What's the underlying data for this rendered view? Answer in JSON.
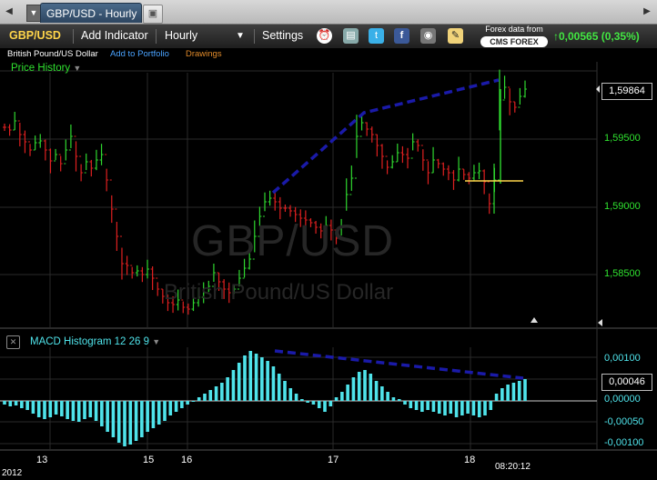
{
  "tab": {
    "title": "GBP/USD - Hourly"
  },
  "toolbar": {
    "symbol": "GBP/USD",
    "add_indicator": "Add Indicator",
    "interval": "Hourly",
    "settings": "Settings",
    "data_source_line1": "Forex data from",
    "data_source_logo": "CMS FOREX",
    "change": "0,00565 (0,35%)"
  },
  "subbar": {
    "instrument_name": "British Pound/US Dollar",
    "add_to_portfolio": "Add to Portfolio",
    "drawings": "Drawings"
  },
  "price_panel": {
    "label": "Price History",
    "watermark_symbol": "GBP/USD",
    "watermark_name": "British Pound/US Dollar",
    "current_price": "1,59864",
    "y_ticks": [
      "1,59500",
      "1,59000",
      "1,58500"
    ]
  },
  "macd_panel": {
    "label": "MACD Histogram 12 26 9",
    "current_value": "0,00046",
    "y_ticks": [
      "0,00100",
      "0,00000",
      "-0,00050",
      "-0,00100"
    ]
  },
  "x_axis": {
    "labels": [
      "13",
      "15",
      "16",
      "17",
      "18"
    ],
    "year": "2012",
    "time": "08:20:12"
  },
  "colors": {
    "up": "#2fd82f",
    "down": "#e02020",
    "macd": "#4fe3ea",
    "trend": "#1a1aa8",
    "grid": "#2a2a2a"
  },
  "chart_data": [
    {
      "type": "ohlc",
      "title": "GBP/USD",
      "interval": "Hourly",
      "y_range": [
        1.581,
        1.6
      ]
    },
    {
      "type": "bar",
      "title": "MACD Histogram 12 26 9",
      "y_range": [
        -0.0011,
        0.0011
      ],
      "last_value": 0.00046
    }
  ]
}
